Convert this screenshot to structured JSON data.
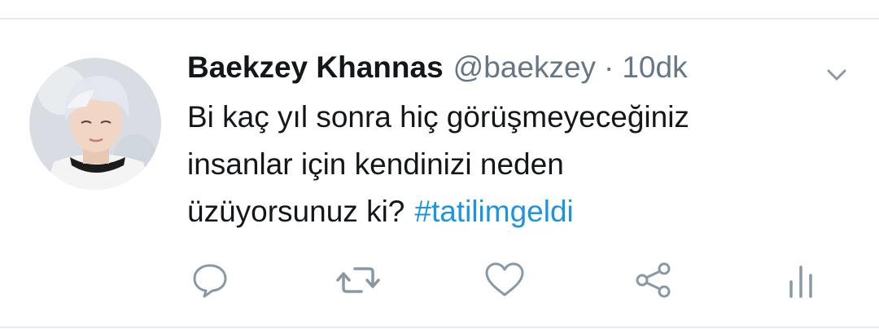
{
  "tweet": {
    "author_name": "Baekzey Khannas",
    "author_handle": "@baekzey",
    "separator": "·",
    "timestamp": "10dk",
    "text_lines": [
      "Bi kaç yıl sonra hiç görüşmeyeceğiniz",
      "insanlar için kendinizi neden",
      "üzüyorsunuz ki?"
    ],
    "hashtag": "#tatilimgeldi"
  },
  "icons": {
    "avatar": "profile-photo",
    "caret": "chevron-down-icon",
    "reply": "reply-icon",
    "retweet": "retweet-icon",
    "like": "heart-icon",
    "share": "share-icon",
    "analytics": "analytics-icon"
  },
  "colors": {
    "text": "#14171a",
    "secondary": "#657786",
    "link": "#1b95e0",
    "icon": "#8899a6",
    "divider": "#e6ecf0"
  }
}
